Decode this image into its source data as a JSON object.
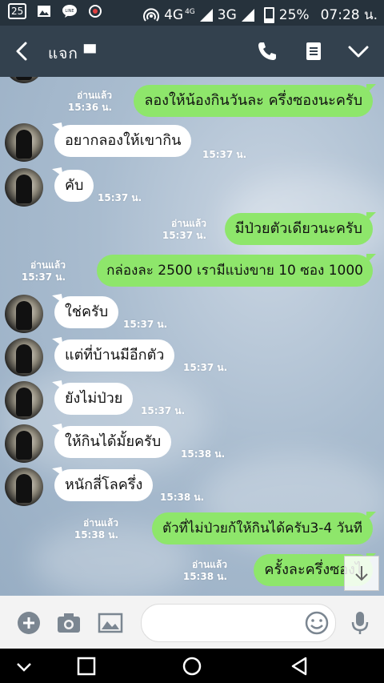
{
  "status_bar": {
    "badge": "25",
    "network": "4G",
    "network_small": "4G",
    "network2": "3G",
    "battery": "25%",
    "time": "07:28 น."
  },
  "header": {
    "chat_name": "แจก  ▀",
    "icons": [
      "back-icon",
      "phone-icon",
      "notes-icon",
      "chevron-down-icon"
    ]
  },
  "messages": [
    {
      "dir": "out",
      "text": "ลองให้น้องกินวันละ ครึ่งซองนะครับ",
      "read": "อ่านแล้ว",
      "time": "15:36 น."
    },
    {
      "dir": "in",
      "text": "อยากลองให้เขากิน",
      "time": "15:37 น."
    },
    {
      "dir": "in",
      "text": "คับ",
      "time": "15:37 น."
    },
    {
      "dir": "out",
      "text": "มีป่วยตัวเดียวนะครับ",
      "read": "อ่านแล้ว",
      "time": "15:37 น."
    },
    {
      "dir": "out",
      "text": "กล่องละ 2500 เรามีแบ่งขาย 10 ซอง 1000",
      "read": "อ่านแล้ว",
      "time": "15:37 น."
    },
    {
      "dir": "in",
      "text": "ใช่ครับ",
      "time": "15:37 น."
    },
    {
      "dir": "in",
      "text": "แต่ที่บ้านมีอีกตัว",
      "time": "15:37 น."
    },
    {
      "dir": "in",
      "text": "ยังไม่ป่วย",
      "time": "15:37 น."
    },
    {
      "dir": "in",
      "text": "ให้กินได้มั้ยครับ",
      "time": "15:38 น."
    },
    {
      "dir": "in",
      "text": "หนักสี่โลครึ่ง",
      "time": "15:38 น."
    },
    {
      "dir": "out",
      "text": "ตัวที่ไม่ป่วยก้ให้กินได้ครับ3-4 วันที",
      "read": "อ่านแล้ว",
      "time": "15:38 น."
    },
    {
      "dir": "out",
      "text": "ครั้งละครึ่งซองไ",
      "read": "อ่านแล้ว",
      "time": "15:38 น."
    }
  ],
  "input": {
    "placeholder": "",
    "icons": [
      "add-icon",
      "camera-icon",
      "image-icon",
      "emoji-icon",
      "microphone-icon"
    ]
  },
  "nav": {
    "icons": [
      "collapse-icon",
      "recents-icon",
      "home-icon",
      "back-triangle-icon"
    ]
  },
  "colors": {
    "outgoing_bubble": "#8ee66b",
    "incoming_bubble": "#ffffff",
    "header": "#33414e"
  }
}
